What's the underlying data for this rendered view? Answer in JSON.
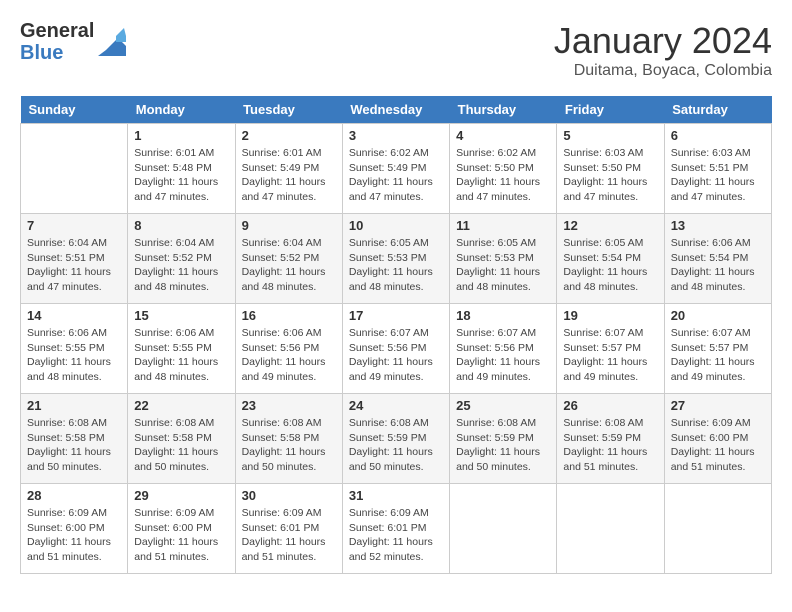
{
  "logo": {
    "general": "General",
    "blue": "Blue"
  },
  "title": "January 2024",
  "location": "Duitama, Boyaca, Colombia",
  "weekdays": [
    "Sunday",
    "Monday",
    "Tuesday",
    "Wednesday",
    "Thursday",
    "Friday",
    "Saturday"
  ],
  "weeks": [
    [
      {
        "day": "",
        "info": ""
      },
      {
        "day": "1",
        "info": "Sunrise: 6:01 AM\nSunset: 5:48 PM\nDaylight: 11 hours\nand 47 minutes."
      },
      {
        "day": "2",
        "info": "Sunrise: 6:01 AM\nSunset: 5:49 PM\nDaylight: 11 hours\nand 47 minutes."
      },
      {
        "day": "3",
        "info": "Sunrise: 6:02 AM\nSunset: 5:49 PM\nDaylight: 11 hours\nand 47 minutes."
      },
      {
        "day": "4",
        "info": "Sunrise: 6:02 AM\nSunset: 5:50 PM\nDaylight: 11 hours\nand 47 minutes."
      },
      {
        "day": "5",
        "info": "Sunrise: 6:03 AM\nSunset: 5:50 PM\nDaylight: 11 hours\nand 47 minutes."
      },
      {
        "day": "6",
        "info": "Sunrise: 6:03 AM\nSunset: 5:51 PM\nDaylight: 11 hours\nand 47 minutes."
      }
    ],
    [
      {
        "day": "7",
        "info": "Sunrise: 6:04 AM\nSunset: 5:51 PM\nDaylight: 11 hours\nand 47 minutes."
      },
      {
        "day": "8",
        "info": "Sunrise: 6:04 AM\nSunset: 5:52 PM\nDaylight: 11 hours\nand 48 minutes."
      },
      {
        "day": "9",
        "info": "Sunrise: 6:04 AM\nSunset: 5:52 PM\nDaylight: 11 hours\nand 48 minutes."
      },
      {
        "day": "10",
        "info": "Sunrise: 6:05 AM\nSunset: 5:53 PM\nDaylight: 11 hours\nand 48 minutes."
      },
      {
        "day": "11",
        "info": "Sunrise: 6:05 AM\nSunset: 5:53 PM\nDaylight: 11 hours\nand 48 minutes."
      },
      {
        "day": "12",
        "info": "Sunrise: 6:05 AM\nSunset: 5:54 PM\nDaylight: 11 hours\nand 48 minutes."
      },
      {
        "day": "13",
        "info": "Sunrise: 6:06 AM\nSunset: 5:54 PM\nDaylight: 11 hours\nand 48 minutes."
      }
    ],
    [
      {
        "day": "14",
        "info": "Sunrise: 6:06 AM\nSunset: 5:55 PM\nDaylight: 11 hours\nand 48 minutes."
      },
      {
        "day": "15",
        "info": "Sunrise: 6:06 AM\nSunset: 5:55 PM\nDaylight: 11 hours\nand 48 minutes."
      },
      {
        "day": "16",
        "info": "Sunrise: 6:06 AM\nSunset: 5:56 PM\nDaylight: 11 hours\nand 49 minutes."
      },
      {
        "day": "17",
        "info": "Sunrise: 6:07 AM\nSunset: 5:56 PM\nDaylight: 11 hours\nand 49 minutes."
      },
      {
        "day": "18",
        "info": "Sunrise: 6:07 AM\nSunset: 5:56 PM\nDaylight: 11 hours\nand 49 minutes."
      },
      {
        "day": "19",
        "info": "Sunrise: 6:07 AM\nSunset: 5:57 PM\nDaylight: 11 hours\nand 49 minutes."
      },
      {
        "day": "20",
        "info": "Sunrise: 6:07 AM\nSunset: 5:57 PM\nDaylight: 11 hours\nand 49 minutes."
      }
    ],
    [
      {
        "day": "21",
        "info": "Sunrise: 6:08 AM\nSunset: 5:58 PM\nDaylight: 11 hours\nand 50 minutes."
      },
      {
        "day": "22",
        "info": "Sunrise: 6:08 AM\nSunset: 5:58 PM\nDaylight: 11 hours\nand 50 minutes."
      },
      {
        "day": "23",
        "info": "Sunrise: 6:08 AM\nSunset: 5:58 PM\nDaylight: 11 hours\nand 50 minutes."
      },
      {
        "day": "24",
        "info": "Sunrise: 6:08 AM\nSunset: 5:59 PM\nDaylight: 11 hours\nand 50 minutes."
      },
      {
        "day": "25",
        "info": "Sunrise: 6:08 AM\nSunset: 5:59 PM\nDaylight: 11 hours\nand 50 minutes."
      },
      {
        "day": "26",
        "info": "Sunrise: 6:08 AM\nSunset: 5:59 PM\nDaylight: 11 hours\nand 51 minutes."
      },
      {
        "day": "27",
        "info": "Sunrise: 6:09 AM\nSunset: 6:00 PM\nDaylight: 11 hours\nand 51 minutes."
      }
    ],
    [
      {
        "day": "28",
        "info": "Sunrise: 6:09 AM\nSunset: 6:00 PM\nDaylight: 11 hours\nand 51 minutes."
      },
      {
        "day": "29",
        "info": "Sunrise: 6:09 AM\nSunset: 6:00 PM\nDaylight: 11 hours\nand 51 minutes."
      },
      {
        "day": "30",
        "info": "Sunrise: 6:09 AM\nSunset: 6:01 PM\nDaylight: 11 hours\nand 51 minutes."
      },
      {
        "day": "31",
        "info": "Sunrise: 6:09 AM\nSunset: 6:01 PM\nDaylight: 11 hours\nand 52 minutes."
      },
      {
        "day": "",
        "info": ""
      },
      {
        "day": "",
        "info": ""
      },
      {
        "day": "",
        "info": ""
      }
    ]
  ]
}
